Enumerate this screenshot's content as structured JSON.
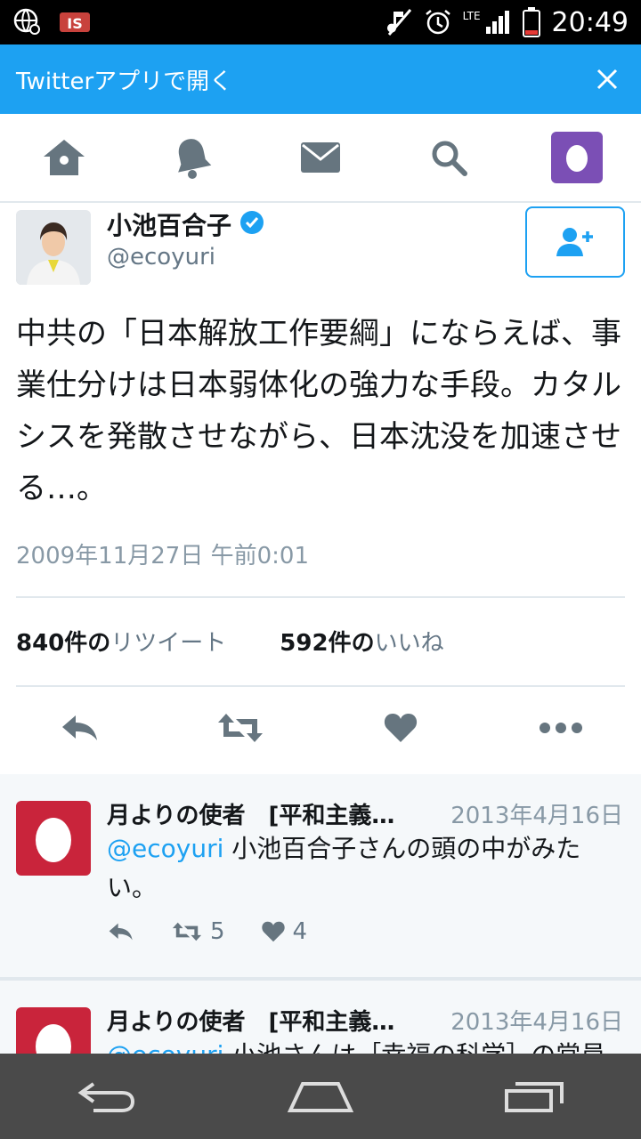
{
  "status_bar": {
    "time": "20:49",
    "network": "LTE",
    "icons": [
      "globe-icon",
      "battery-saver-icon",
      "mute-icon",
      "alarm-icon",
      "signal-icon",
      "battery-icon"
    ]
  },
  "banner": {
    "label": "Twitterアプリで開く",
    "close_icon": "close-icon"
  },
  "nav": {
    "items": [
      "home-icon",
      "notifications-icon",
      "messages-icon",
      "search-icon",
      "profile-avatar"
    ]
  },
  "tweet": {
    "name": "小池百合子",
    "handle": "@ecoyuri",
    "verified": true,
    "text": "中共の「日本解放工作要綱」にならえば、事業仕分けは日本弱体化の強力な手段。カタルシスを発散させながら、日本沈没を加速させる…。",
    "date": "2009年11月27日 午前0:01",
    "retweets_count": "840件の",
    "retweets_label": "リツイート",
    "likes_count": "592件の",
    "likes_label": "いいね"
  },
  "replies": [
    {
      "name": "月よりの使者　[平和主義…",
      "date": "2013年4月16日",
      "mention": "@ecoyuri",
      "text": " 小池百合子さんの頭の中がみたい。",
      "retweets": "5",
      "likes": "4"
    },
    {
      "name": "月よりの使者　[平和主義…",
      "date": "2013年4月16日",
      "mention": "@ecoyuri",
      "text": " 小池さんは［幸福の科学］の常員"
    }
  ],
  "colors": {
    "brand": "#1da1f2",
    "banner": "#1da1f2",
    "avatar_purple": "#7b4fb5",
    "reply_avatar": "#c9243b"
  }
}
